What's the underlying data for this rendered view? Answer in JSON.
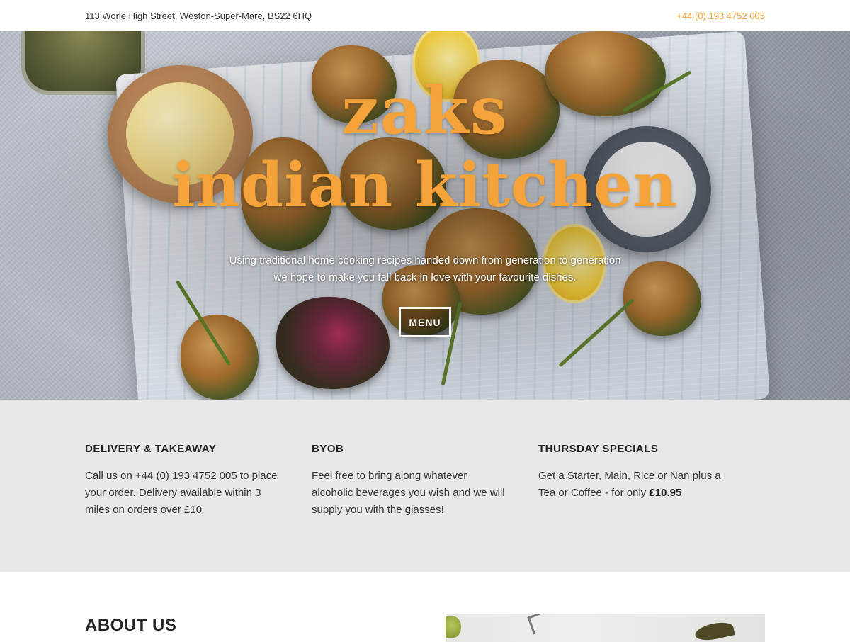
{
  "topbar": {
    "address": "113 Worle High Street, Weston-Super-Mare, BS22 6HQ",
    "phone": "+44 (0) 193 4752 005"
  },
  "hero": {
    "brand_line1": "zaks",
    "brand_line2": "indian kitchen",
    "tagline_line1": "Using traditional home cooking recipes handed down from generation to generation",
    "tagline_line2": "we hope to make you fall back in love with your favourite dishes.",
    "menu_button": "MENU"
  },
  "features": [
    {
      "title": "DELIVERY & TAKEAWAY",
      "text": "Call us on +44 (0) 193 4752 005 to place your order. Delivery available within 3 miles on orders over £10"
    },
    {
      "title": "BYOB",
      "text": "Feel free to bring along whatever alcoholic beverages you wish and we will supply you with the glasses!"
    },
    {
      "title": "THURSDAY SPECIALS",
      "text": "Get a Starter, Main, Rice or Nan plus a Tea or Coffee - for only ",
      "price": "£10.95"
    }
  ],
  "about": {
    "title": "ABOUT US"
  },
  "colors": {
    "accent": "#f4a23a",
    "features_bg": "#e8e8e8"
  }
}
